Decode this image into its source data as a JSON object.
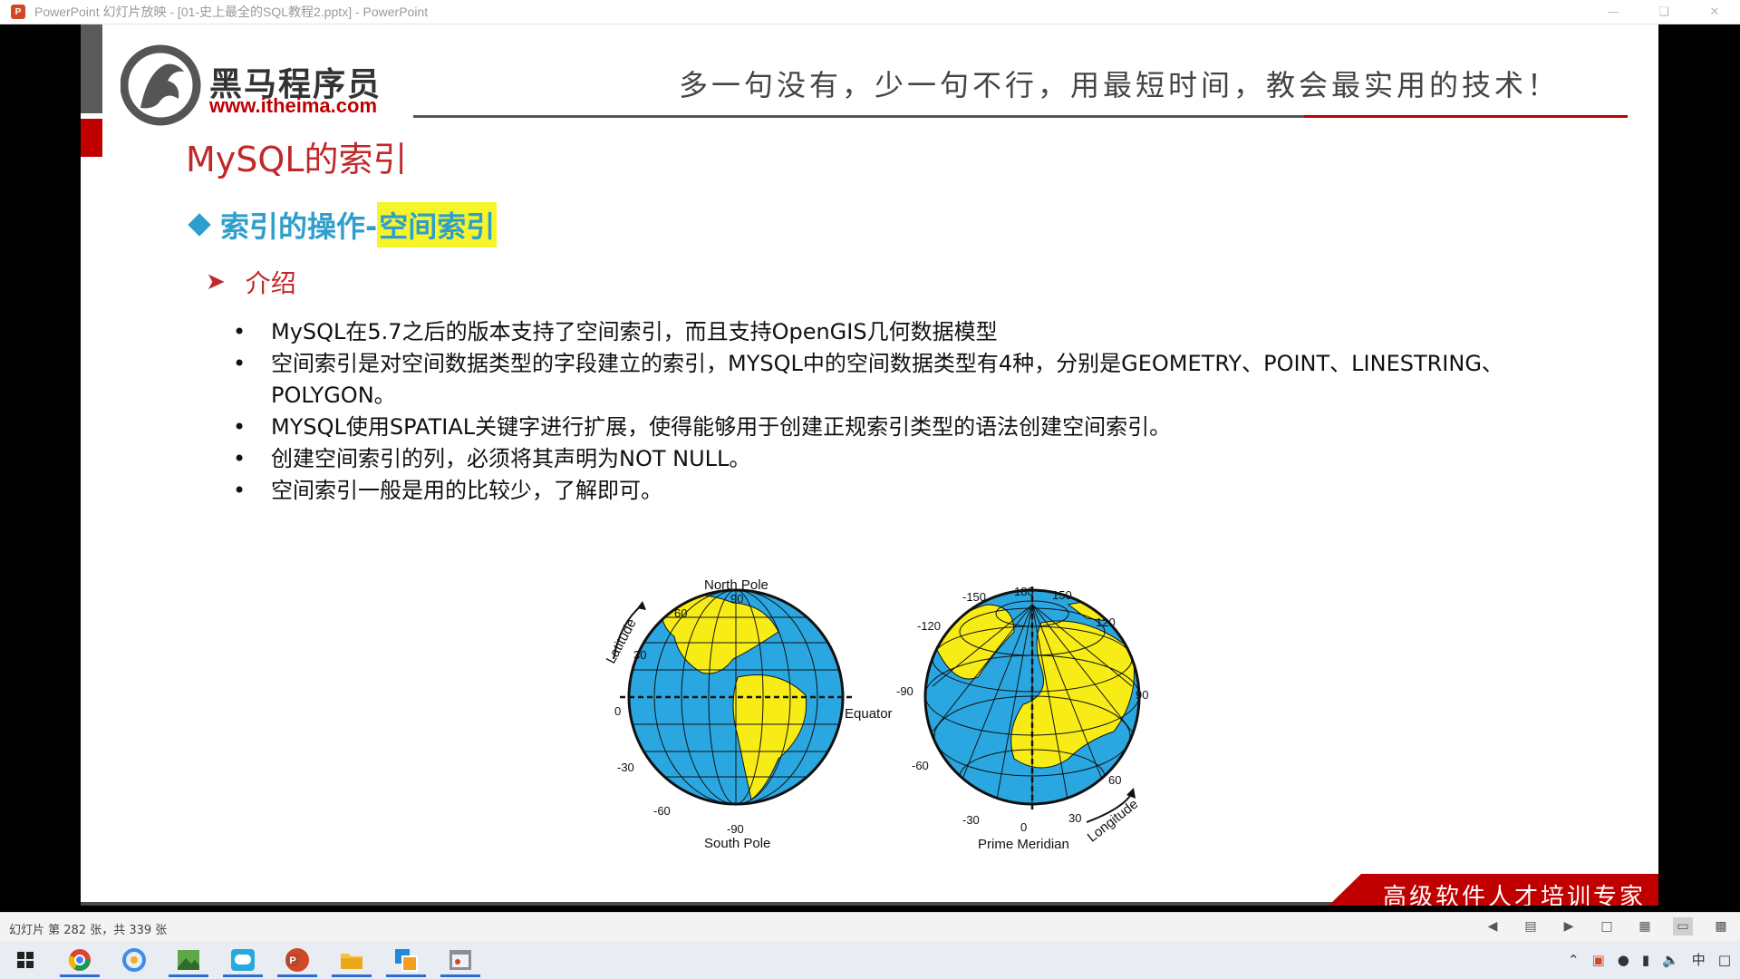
{
  "window": {
    "title": "PowerPoint 幻灯片放映 - [01-史上最全的SQL教程2.pptx] - PowerPoint",
    "app_icon": "P"
  },
  "slide": {
    "logo": {
      "name_cn": "黑马程序员",
      "url": "www.itheima.com"
    },
    "slogan": "多一句没有，少一句不行，用最短时间，教会最实用的技术！",
    "title": "MySQL的索引",
    "section": {
      "prefix": "索引的操作-",
      "highlight": "空间索引"
    },
    "subsection": "介绍",
    "bullet_symbol": "•",
    "bullets": [
      "MySQL在5.7之后的版本支持了空间索引，而且支持OpenGIS几何数据模型",
      "空间索引是对空间数据类型的字段建立的索引，MYSQL中的空间数据类型有4种，分别是GEOMETRY、POINT、LINESTRING、POLYGON。",
      "MYSQL使用SPATIAL关键字进行扩展，使得能够用于创建正规索引类型的语法创建空间索引。",
      "创建空间索引的列，必须将其声明为NOT NULL。",
      "空间索引一般是用的比较少，了解即可。"
    ],
    "figure": {
      "left_globe": {
        "north": "North Pole",
        "south": "South Pole",
        "equator": "Equator",
        "axis": "Latitude",
        "ticks": {
          "t90": "90",
          "t60": "60",
          "t30": "30",
          "t0": "0",
          "tm30": "-30",
          "tm60": "-60",
          "tm90": "-90"
        }
      },
      "right_globe": {
        "meridian": "Prime Meridian",
        "axis": "Longitude",
        "ticks": {
          "t180": "180",
          "tm150": "-150",
          "t150": "150",
          "tm120": "-120",
          "t120": "120",
          "tm90": "-90",
          "t90": "90",
          "tm60": "-60",
          "t60": "60",
          "tm30": "-30",
          "t30": "30",
          "t0": "0"
        }
      },
      "colors": {
        "ocean": "#2aa7e0",
        "land": "#f7ec16",
        "grid": "#111111"
      }
    },
    "badge": "高级软件人才培训专家"
  },
  "statusbar": {
    "slide_info": "幻灯片 第 282 张，共 339 张"
  }
}
